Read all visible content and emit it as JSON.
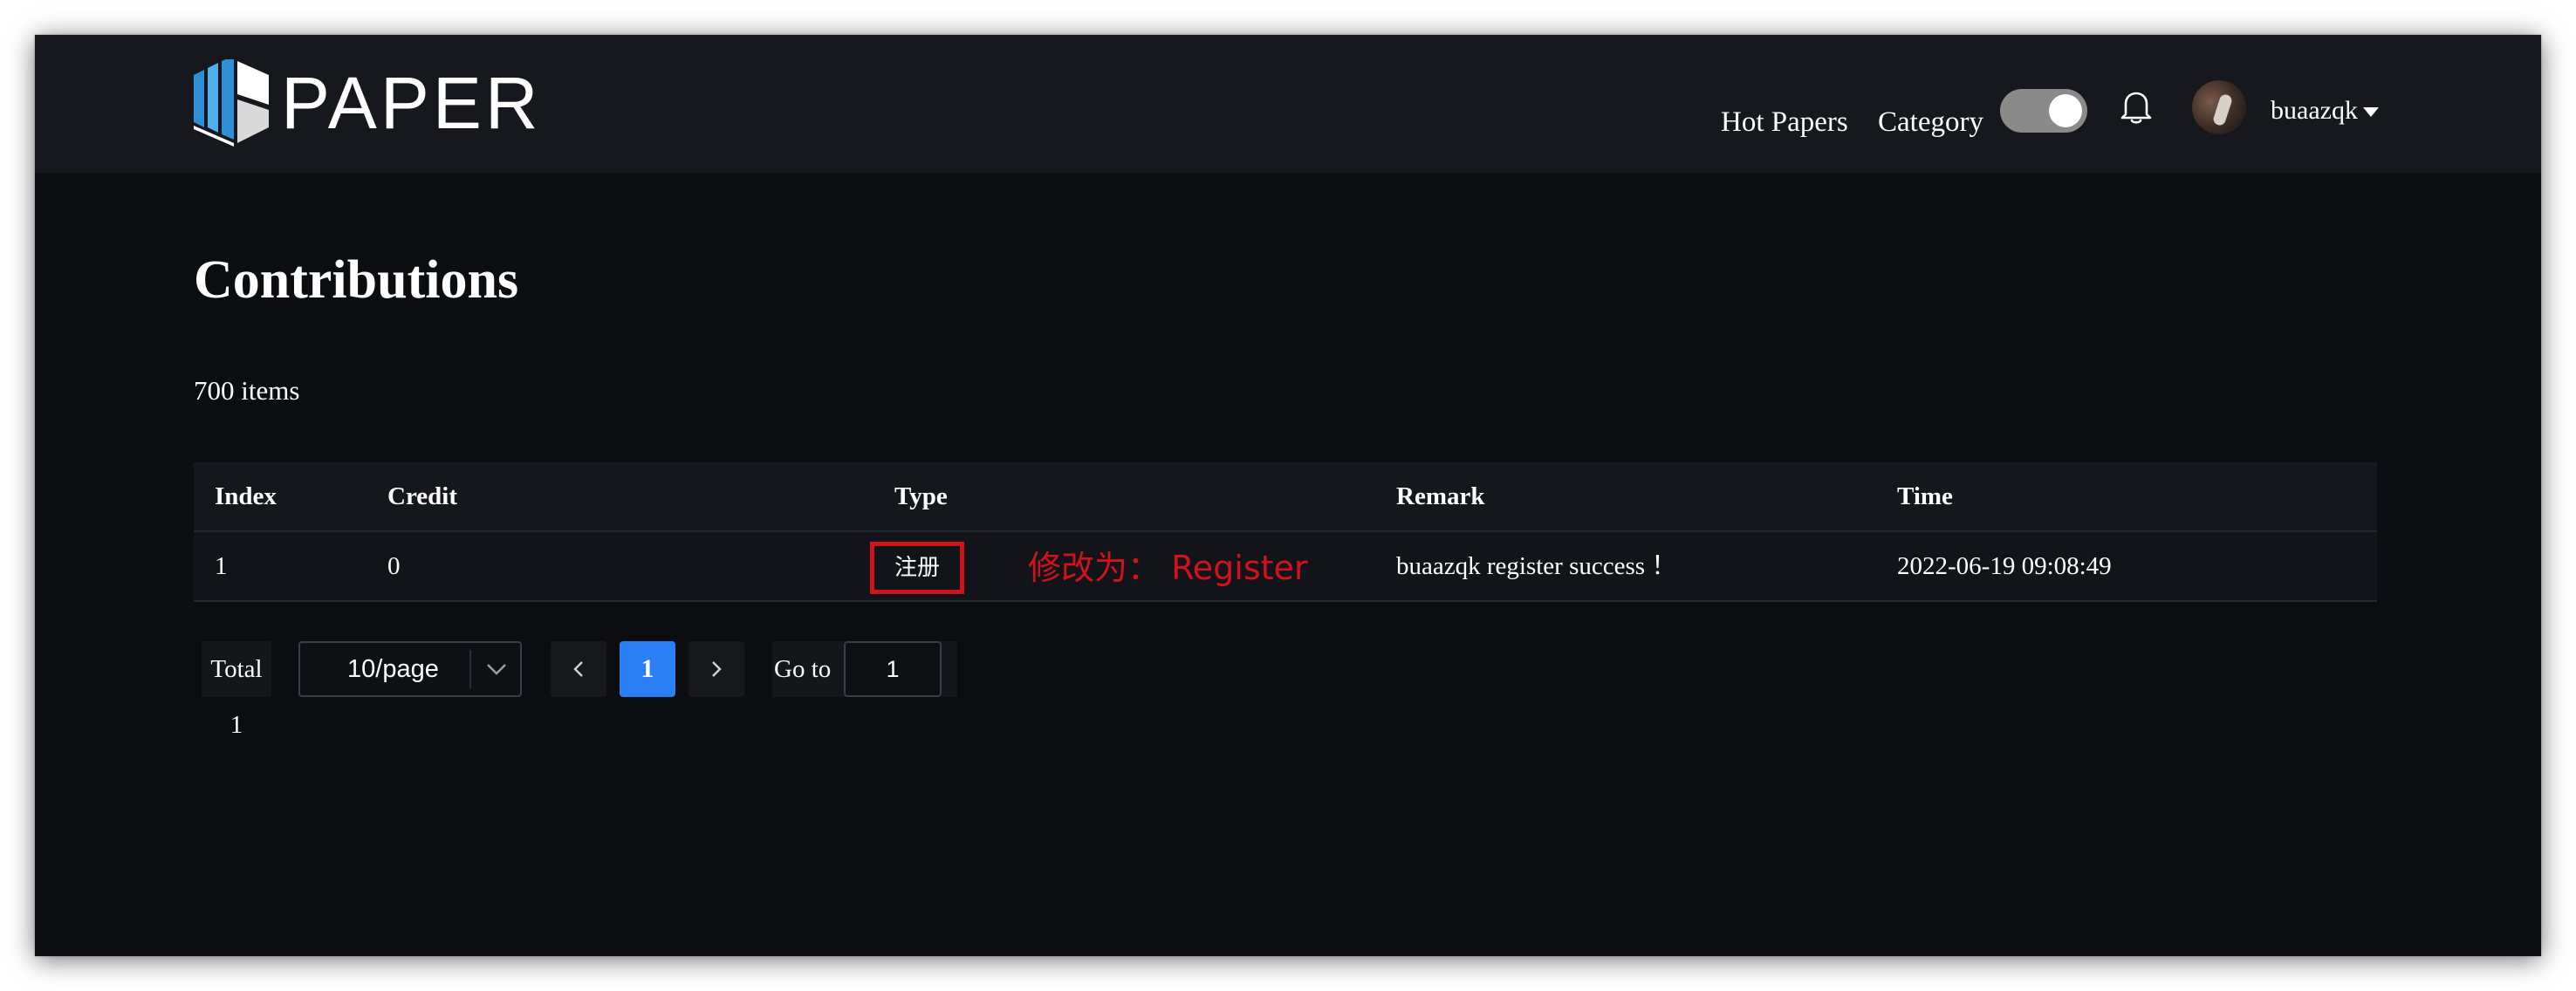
{
  "header": {
    "logo_text": "PAPER",
    "nav": {
      "hot_papers": "Hot Papers",
      "category": "Category"
    },
    "toggle_on": true,
    "username": "buaazqk"
  },
  "main": {
    "title": "Contributions",
    "item_count": "700 items"
  },
  "table": {
    "headers": {
      "index": "Index",
      "credit": "Credit",
      "type": "Type",
      "remark": "Remark",
      "time": "Time"
    },
    "rows": [
      {
        "index": "1",
        "credit": "0",
        "type": "注册",
        "remark": "buaazqk register success ！",
        "time": "2022-06-19 09:08:49"
      }
    ]
  },
  "annotation": {
    "text": "修改为：  Register",
    "color": "#d0121b"
  },
  "pagination": {
    "total": "Total 1",
    "page_size": "10/page",
    "current_page": "1",
    "goto_label": "Go to",
    "goto_value": "1"
  },
  "colors": {
    "background": "#0b0d11",
    "header": "#16181d",
    "accent": "#2a7ff5"
  }
}
